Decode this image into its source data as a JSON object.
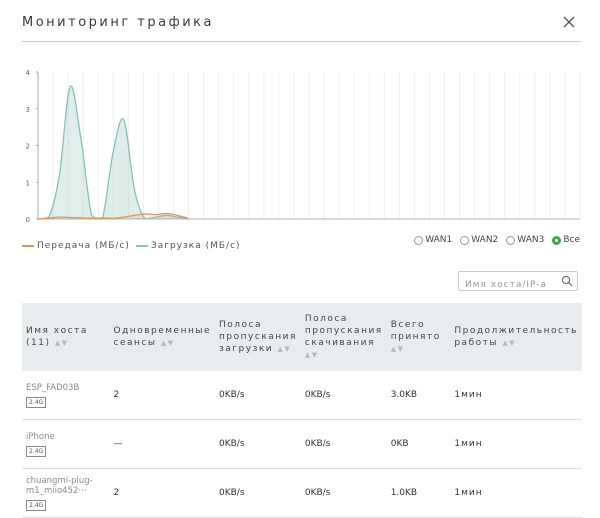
{
  "dialog": {
    "title": "Мониторинг трафика"
  },
  "chart_data": {
    "type": "area",
    "yticks": [
      "0",
      "1",
      "2",
      "3",
      "4"
    ],
    "ylim": [
      0,
      4
    ],
    "series": [
      {
        "name": "Передача (МБ/с)",
        "color": "#e0955c",
        "values": [
          0,
          0.02,
          0.05,
          0.04,
          0.03,
          0.02,
          0.03,
          0.02,
          0.05,
          0.1,
          0.14,
          0.12,
          0.15,
          0.1,
          0.02
        ]
      },
      {
        "name": "Загрузка (МБ/с)",
        "color": "#8cbfb8",
        "values": [
          0,
          0.05,
          1.2,
          3.6,
          2.2,
          0.1,
          0.0,
          1.8,
          2.7,
          0.8,
          0.0,
          0.05,
          0.1,
          0.05,
          0.02
        ]
      }
    ]
  },
  "legend": {
    "tx": "Передача (МБ/с)",
    "rx": "Загрузка (МБ/с)"
  },
  "radios": [
    {
      "label": "WAN1",
      "checked": false
    },
    {
      "label": "WAN2",
      "checked": false
    },
    {
      "label": "WAN3",
      "checked": false
    },
    {
      "label": "Все",
      "checked": true
    }
  ],
  "search": {
    "placeholder": "Имя хоста/IP-а"
  },
  "table": {
    "headers": [
      "Имя хоста (11)",
      "Одновременные сеансы",
      "Полоса пропускания загрузки",
      "Полоса пропускания скачивания",
      "Всего принято",
      "Продолжительность работы"
    ],
    "rows": [
      {
        "host": "ESP_FAD03B",
        "badge": "2.4G",
        "sessions": "2",
        "up": "0KB/s",
        "down": "0KB/s",
        "total": "3.0KB",
        "duration": "1мин"
      },
      {
        "host": "iPhone",
        "badge": "2.4G",
        "sessions": "—",
        "up": "0KB/s",
        "down": "0KB/s",
        "total": "0KB",
        "duration": "1мин"
      },
      {
        "host": "chuangmi-plug-m1_miio452···",
        "badge": "2.4G",
        "sessions": "2",
        "up": "0KB/s",
        "down": "0KB/s",
        "total": "1.0KB",
        "duration": "1мин"
      }
    ]
  }
}
